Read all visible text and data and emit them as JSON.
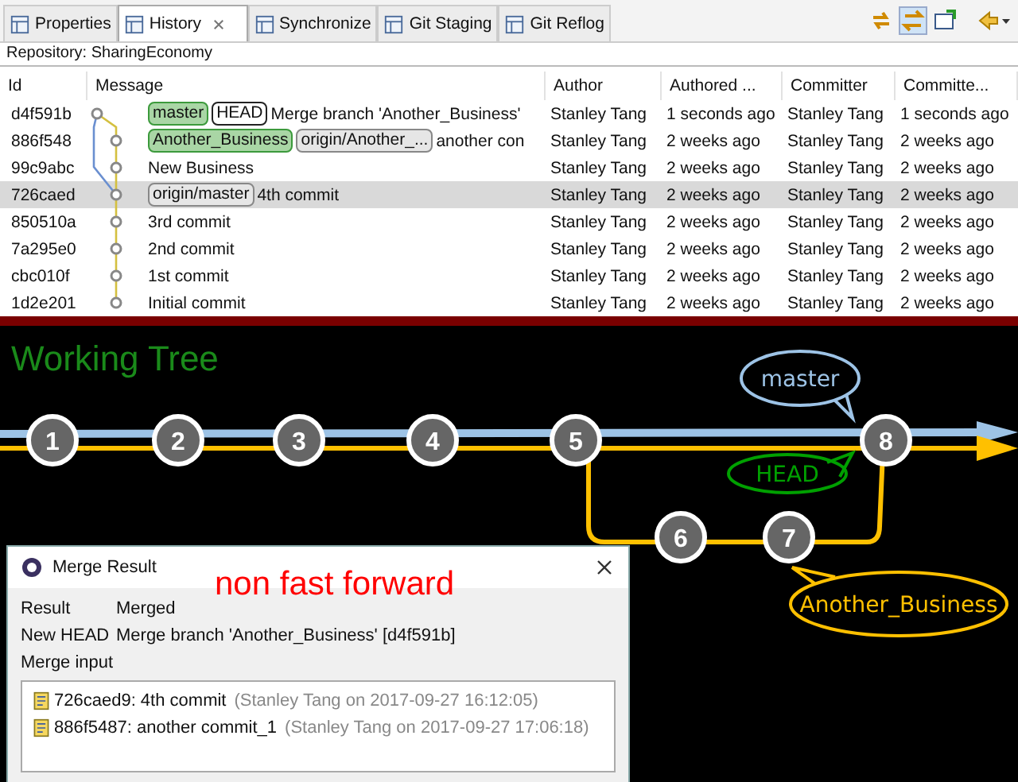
{
  "tabs": [
    {
      "label": "Properties",
      "selected": false,
      "closable": false
    },
    {
      "label": "History",
      "selected": true,
      "closable": true
    },
    {
      "label": "Synchronize",
      "selected": false,
      "closable": false
    },
    {
      "label": "Git Staging",
      "selected": false,
      "closable": false
    },
    {
      "label": "Git Reflog",
      "selected": false,
      "closable": false
    }
  ],
  "repository": "Repository: SharingEconomy",
  "table": {
    "columns": [
      "Id",
      "Message",
      "Author",
      "Authored ...",
      "Committer",
      "Committe..."
    ],
    "rows": [
      {
        "id": "d4f591b",
        "refs": [
          {
            "label": "master",
            "kind": "local"
          },
          {
            "label": "HEAD",
            "kind": "head"
          }
        ],
        "message": "Merge branch 'Another_Business'",
        "author": "Stanley Tang",
        "authored": "1 seconds ago",
        "committer": "Stanley Tang",
        "committed": "1 seconds ago",
        "selected": false
      },
      {
        "id": "886f548",
        "refs": [
          {
            "label": "Another_Business",
            "kind": "local"
          },
          {
            "label": "origin/Another_...",
            "kind": "remote"
          }
        ],
        "message": "another con",
        "author": "Stanley Tang",
        "authored": "2 weeks ago",
        "committer": "Stanley Tang",
        "committed": "2 weeks ago",
        "selected": false
      },
      {
        "id": "99c9abc",
        "refs": [],
        "message": "New Business",
        "author": "Stanley Tang",
        "authored": "2 weeks ago",
        "committer": "Stanley Tang",
        "committed": "2 weeks ago",
        "selected": false
      },
      {
        "id": "726caed",
        "refs": [
          {
            "label": "origin/master",
            "kind": "remote"
          }
        ],
        "message": "4th commit",
        "author": "Stanley Tang",
        "authored": "2 weeks ago",
        "committer": "Stanley Tang",
        "committed": "2 weeks ago",
        "selected": true
      },
      {
        "id": "850510a",
        "refs": [],
        "message": "3rd commit",
        "author": "Stanley Tang",
        "authored": "2 weeks ago",
        "committer": "Stanley Tang",
        "committed": "2 weeks ago",
        "selected": false
      },
      {
        "id": "7a295e0",
        "refs": [],
        "message": "2nd commit",
        "author": "Stanley Tang",
        "authored": "2 weeks ago",
        "committer": "Stanley Tang",
        "committed": "2 weeks ago",
        "selected": false
      },
      {
        "id": "cbc010f",
        "refs": [],
        "message": "1st commit",
        "author": "Stanley Tang",
        "authored": "2 weeks ago",
        "committer": "Stanley Tang",
        "committed": "2 weeks ago",
        "selected": false
      },
      {
        "id": "1d2e201",
        "refs": [],
        "message": "Initial commit",
        "author": "Stanley Tang",
        "authored": "2 weeks ago",
        "committer": "Stanley Tang",
        "committed": "2 weeks ago",
        "selected": false
      }
    ]
  },
  "diagram": {
    "title": "Working Tree",
    "nodes": [
      {
        "label": "1"
      },
      {
        "label": "2"
      },
      {
        "label": "3"
      },
      {
        "label": "4"
      },
      {
        "label": "5"
      },
      {
        "label": "6"
      },
      {
        "label": "7"
      },
      {
        "label": "8"
      }
    ],
    "callouts": [
      {
        "label": "master",
        "color": "#9dc3e6"
      },
      {
        "label": "HEAD",
        "color": "#00a000"
      },
      {
        "label": "Another_Business",
        "color": "#ffc000"
      }
    ],
    "annotation": "non fast forward"
  },
  "dialog": {
    "title": "Merge Result",
    "fields": [
      {
        "label": "Result",
        "value": "Merged"
      },
      {
        "label": "New HEAD",
        "value": "Merge branch 'Another_Business' [d4f591b]"
      }
    ],
    "inputs_label": "Merge input",
    "inputs": [
      {
        "commit": "726caed9: 4th commit",
        "detail": "(Stanley Tang on 2017-09-27 16:12:05)"
      },
      {
        "commit": "886f5487: another commit_1",
        "detail": "(Stanley Tang on 2017-09-27 17:06:18)"
      }
    ]
  }
}
